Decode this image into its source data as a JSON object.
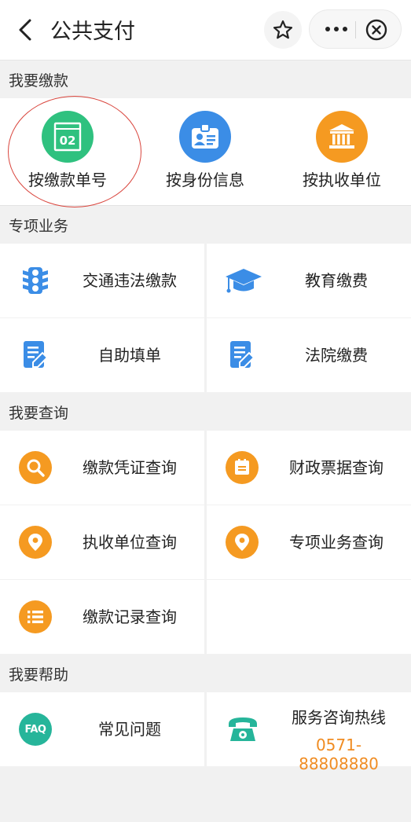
{
  "header": {
    "title": "公共支付"
  },
  "sections": {
    "pay": "我要缴款",
    "special": "专项业务",
    "query": "我要查询",
    "help": "我要帮助"
  },
  "pay_options": [
    {
      "label": "按缴款单号",
      "icon": "payment-number-icon",
      "icon_text": "02",
      "color": "#2fc17f"
    },
    {
      "label": "按身份信息",
      "icon": "id-card-icon",
      "color": "#3b8de6"
    },
    {
      "label": "按执收单位",
      "icon": "building-icon",
      "color": "#f59a21"
    }
  ],
  "special": [
    {
      "label": "交通违法缴款",
      "icon": "traffic-light-icon"
    },
    {
      "label": "教育缴费",
      "icon": "graduation-cap-icon"
    },
    {
      "label": "自助填单",
      "icon": "edit-form-icon"
    },
    {
      "label": "法院缴费",
      "icon": "edit-form-icon"
    }
  ],
  "query": [
    {
      "label": "缴款凭证查询",
      "icon": "magnifier-icon"
    },
    {
      "label": "财政票据查询",
      "icon": "receipt-icon"
    },
    {
      "label": "执收单位查询",
      "icon": "location-pin-icon"
    },
    {
      "label": "专项业务查询",
      "icon": "location-pin-icon"
    },
    {
      "label": "缴款记录查询",
      "icon": "list-icon"
    }
  ],
  "help": {
    "faq": {
      "label": "常见问题",
      "icon_text": "FAQ",
      "icon": "faq-icon"
    },
    "hotline": {
      "label": "服务咨询热线",
      "phone": "0571-88808880",
      "icon": "telephone-icon"
    }
  },
  "colors": {
    "green": "#2fc17f",
    "blue": "#3b8de6",
    "orange": "#f59a21",
    "phone_orange": "#f08c22",
    "teal": "#26b59a",
    "highlight_ring": "#d9453d"
  }
}
